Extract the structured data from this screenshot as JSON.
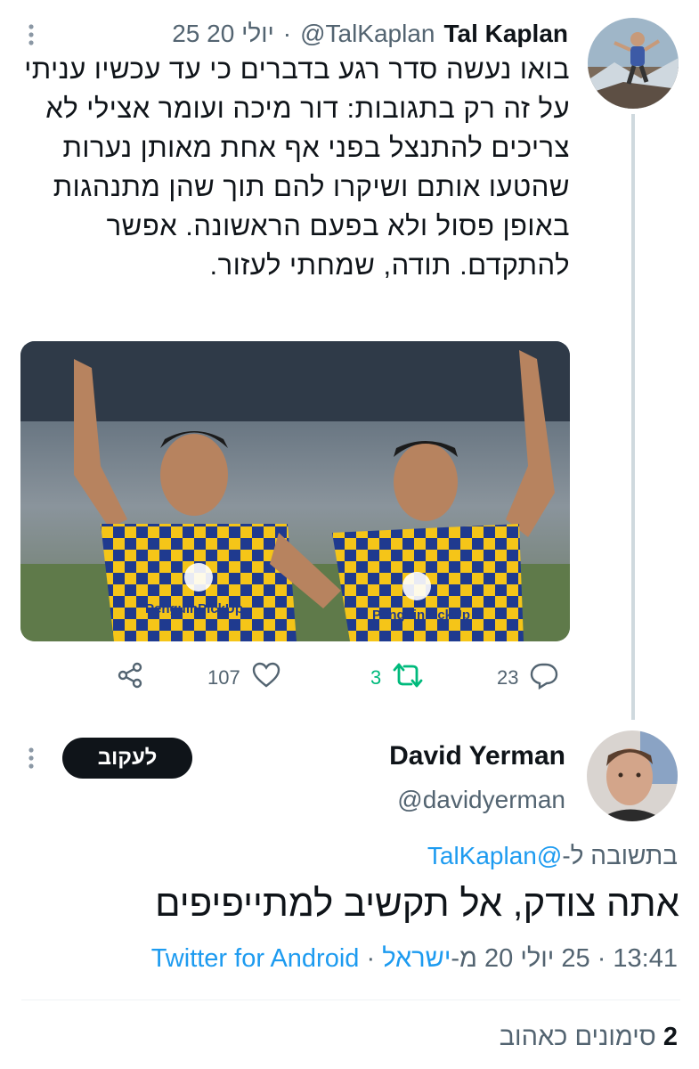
{
  "tweet1": {
    "author_name": "Tal Kaplan",
    "author_handle": "@TalKaplan",
    "separator": "·",
    "date": "25 יולי 20",
    "text": "בואו נעשה סדר רגע בדברים כי עד עכשיו עניתי על זה רק בתגובות: דור מיכה ועומר אצילי לא צריכים להתנצל בפני אף אחת מאותן נערות שהטעו אותם ושיקרו להם תוך שהן מתנהגות באופן פסול ולא בפעם הראשונה. אפשר להתקדם. תודה, שמחתי לעזור.",
    "image_text": "PenguinPickUp",
    "actions": {
      "replies": "23",
      "retweets": "3",
      "likes": "107"
    }
  },
  "tweet2": {
    "author_name": "David Yerman",
    "author_handle": "@davidyerman",
    "follow_label": "לעקוב",
    "reply_prefix": "בתשובה ל-",
    "reply_to": "@TalKaplan",
    "text": "אתה צודק, אל תקשיב למתייפיפים",
    "time": "13:41",
    "date": "25 יולי 20",
    "location_prefix": "מ-",
    "location": "ישראל",
    "client": "Twitter for Android",
    "likes_count": "2",
    "likes_label": "סימונים כאהוב"
  },
  "icons": [
    "more-icon",
    "reply-icon",
    "retweet-icon",
    "like-icon",
    "share-icon"
  ],
  "colors": {
    "link": "#1d9bf0",
    "retweet": "#00ba7c",
    "muted": "#536471",
    "follow_bg": "#0f1419",
    "jersey_yellow": "#f5c518",
    "jersey_blue": "#1f3a8f"
  }
}
